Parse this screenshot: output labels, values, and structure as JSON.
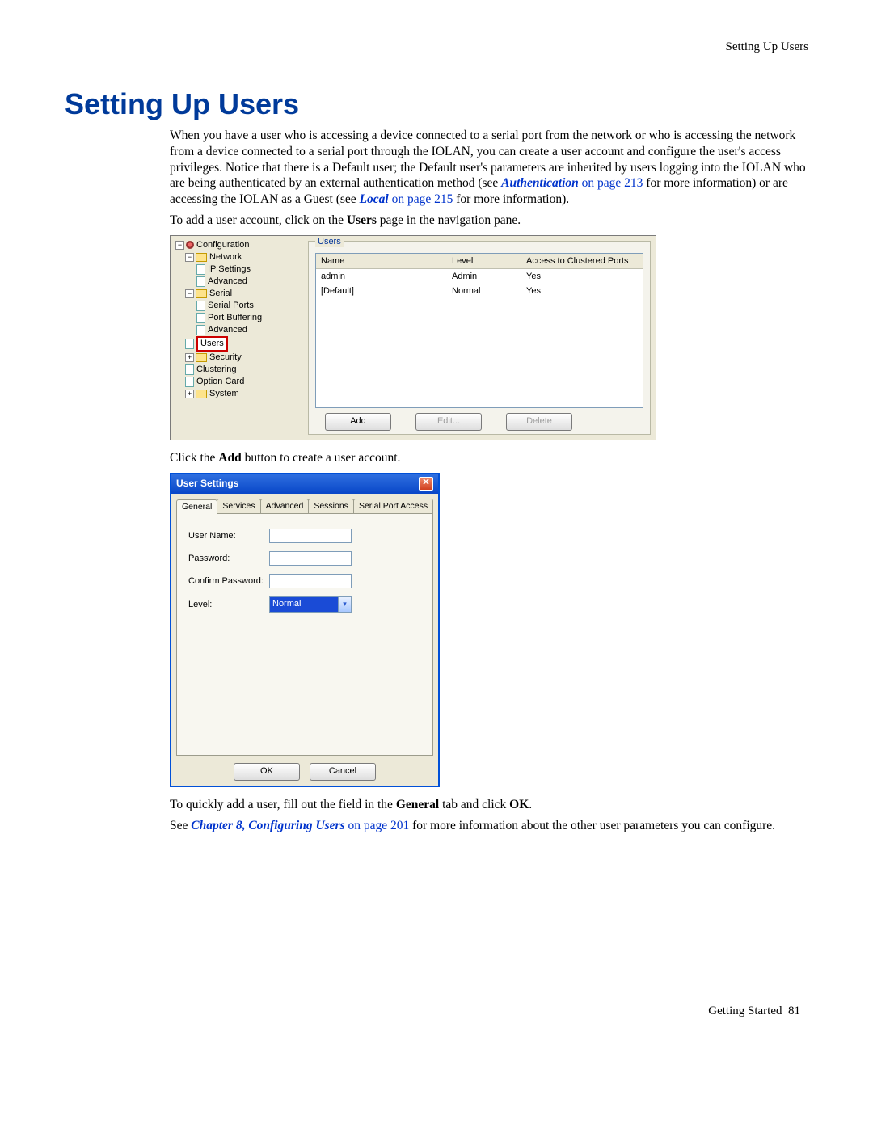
{
  "header_right": "Setting Up Users",
  "title": "Setting Up Users",
  "para1a": "When you have a user who is accessing a device connected to a serial port from the network or who is accessing the network from a device connected to a serial port through the IOLAN, you can create a user account and configure the user's access privileges. Notice that there is a Default user; the Default user's parameters are inherited by users logging into the IOLAN who are being authenticated by an external authentication method (see ",
  "link_auth": "Authentication",
  "para1b": " on page 213",
  "para1c": " for more information) or are accessing the IOLAN as a Guest (see ",
  "link_local": "Local",
  "para1d": " on page 215",
  "para1e": " for more information).",
  "para2a": "To add a user account, click on the ",
  "para2b": "Users",
  "para2c": " page in the navigation pane.",
  "tree": {
    "root": "Configuration",
    "network": "Network",
    "ipsettings": "IP Settings",
    "advanced": "Advanced",
    "serial": "Serial",
    "serialports": "Serial Ports",
    "portbuf": "Port Buffering",
    "advanced2": "Advanced",
    "users": "Users",
    "security": "Security",
    "clustering": "Clustering",
    "option": "Option Card",
    "system": "System"
  },
  "pane": {
    "group": "Users",
    "col_name": "Name",
    "col_level": "Level",
    "col_acc": "Access to Clustered Ports",
    "rows": [
      {
        "name": "admin",
        "level": "Admin",
        "acc": "Yes"
      },
      {
        "name": "[Default]",
        "level": "Normal",
        "acc": "Yes"
      }
    ],
    "btn_add": "Add",
    "btn_edit": "Edit...",
    "btn_del": "Delete"
  },
  "para3a": "Click the ",
  "para3b": "Add",
  "para3c": " button to create a user account.",
  "dlg": {
    "title": "User Settings",
    "tabs": [
      "General",
      "Services",
      "Advanced",
      "Sessions",
      "Serial Port Access"
    ],
    "lab_user": "User Name:",
    "lab_pass": "Password:",
    "lab_conf": "Confirm Password:",
    "lab_level": "Level:",
    "sel_level": "Normal",
    "btn_ok": "OK",
    "btn_cancel": "Cancel"
  },
  "para4a": "To quickly add a user, fill out the field in the ",
  "para4b": "General",
  "para4c": " tab and click ",
  "para4d": "OK",
  "para4e": ".",
  "para5a": "See ",
  "link_ch8": "Chapter 8, Configuring Users",
  "para5b": " on page 201",
  "para5c": " for more information about the other user parameters you can configure.",
  "footer_text": "Getting Started",
  "footer_page": "81"
}
